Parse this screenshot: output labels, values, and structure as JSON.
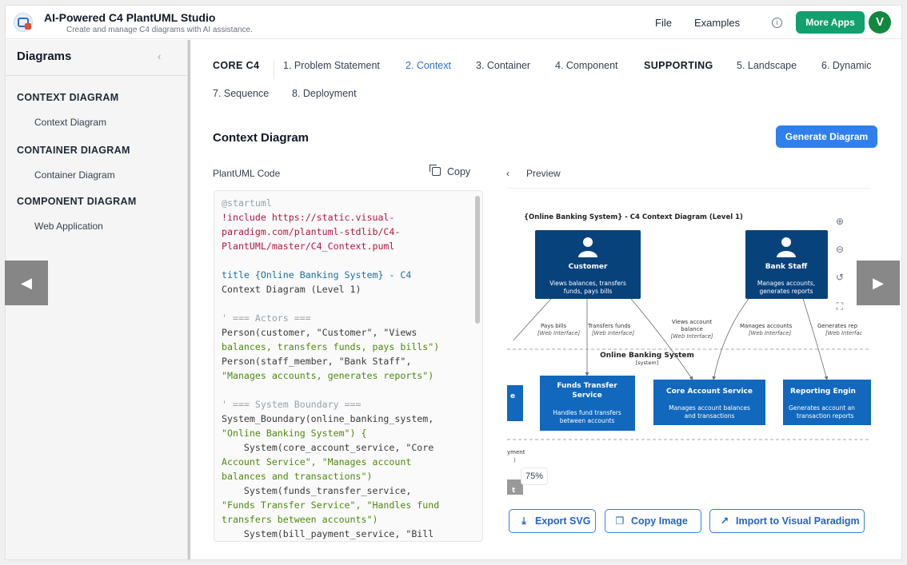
{
  "header": {
    "title": "AI-Powered C4 PlantUML Studio",
    "subtitle": "Create and manage C4 diagrams with AI assistance.",
    "nav_file": "File",
    "nav_examples": "Examples",
    "info_glyph": "i",
    "more_apps": "More Apps",
    "avatar_initial": "V"
  },
  "sidebar": {
    "title": "Diagrams",
    "collapse_glyph": "‹",
    "sections": [
      {
        "heading": "CONTEXT DIAGRAM",
        "item": "Context Diagram"
      },
      {
        "heading": "CONTAINER DIAGRAM",
        "item": "Container Diagram"
      },
      {
        "heading": "COMPONENT DIAGRAM",
        "item": "Web Application"
      }
    ]
  },
  "tabs": {
    "group_core": "CORE C4",
    "t1": "1. Problem Statement",
    "t2": "2. Context",
    "t3": "3. Container",
    "t4": "4. Component",
    "group_supporting": "SUPPORTING",
    "t5": "5. Landscape",
    "t6": "6. Dynamic",
    "t7": "7. Sequence",
    "t8": "8. Deployment"
  },
  "main": {
    "section_title": "Context Diagram",
    "generate_button": "Generate Diagram",
    "code_label": "PlantUML Code",
    "copy_label": "Copy",
    "preview_back_glyph": "‹",
    "preview_label": "Preview",
    "zoom_percent": "75%"
  },
  "code_lines": [
    {
      "text": "@startuml",
      "color": "gray"
    },
    {
      "text": "!include https://static.visual-",
      "color": "red"
    },
    {
      "text": "paradigm.com/plantuml-stdlib/C4-",
      "color": "red"
    },
    {
      "text": "PlantUML/master/C4_Context.puml",
      "color": "red"
    },
    {
      "text": "",
      "color": "dark"
    },
    {
      "text": "title {Online Banking System} - C4",
      "color": "blue"
    },
    {
      "text": "Context Diagram (Level 1)",
      "color": "dark"
    },
    {
      "text": "",
      "color": "dark"
    },
    {
      "text": "' === Actors ===",
      "color": "gray"
    },
    {
      "text": "Person(customer, \"Customer\", \"Views",
      "color": "dark"
    },
    {
      "text": "balances, transfers funds, pays bills\")",
      "color": "green"
    },
    {
      "text": "Person(staff_member, \"Bank Staff\",",
      "color": "dark"
    },
    {
      "text": "\"Manages accounts, generates reports\")",
      "color": "green"
    },
    {
      "text": "",
      "color": "dark"
    },
    {
      "text": "' === System Boundary ===",
      "color": "gray"
    },
    {
      "text": "System_Boundary(online_banking_system,",
      "color": "dark"
    },
    {
      "text": "\"Online Banking System\") {",
      "color": "green"
    },
    {
      "text": "    System(core_account_service, \"Core",
      "color": "dark"
    },
    {
      "text": "Account Service\", \"Manages account",
      "color": "green"
    },
    {
      "text": "balances and transactions\")",
      "color": "green"
    },
    {
      "text": "    System(funds_transfer_service,",
      "color": "dark"
    },
    {
      "text": "\"Funds Transfer Service\", \"Handles fund",
      "color": "green"
    },
    {
      "text": "transfers between accounts\")",
      "color": "green"
    },
    {
      "text": "    System(bill_payment_service, \"Bill",
      "color": "dark"
    }
  ],
  "diagram": {
    "title": "{Online Banking System} - C4 Context Diagram (Level 1)",
    "customer": {
      "name": "Customer",
      "desc1": "Views balances, transfers",
      "desc2": "funds, pays bills"
    },
    "staff": {
      "name": "Bank Staff",
      "desc1": "Manages accounts,",
      "desc2": "generates reports"
    },
    "edge_labels": [
      {
        "l1": "Pays bills",
        "l2": "[Web Interface]"
      },
      {
        "l1": "Transfers funds",
        "l2": "[Web Interface]"
      },
      {
        "l1": "Views account",
        "l2": "balance",
        "l3": "[Web Interface]"
      },
      {
        "l1": "Manages accounts",
        "l2": "[Web Interface]"
      },
      {
        "l1": "Generates rep",
        "l2": "[Web Interfac"
      }
    ],
    "boundary_name": "Online Banking System",
    "boundary_type": "[system]",
    "funds": {
      "n1": "Funds Transfer",
      "n2": "Service",
      "d1": "Handles fund transfers",
      "d2": "between accounts"
    },
    "core": {
      "n1": "Core Account Service",
      "d1": "Manages account balances",
      "d2": "and transactions"
    },
    "reporting": {
      "n1": "Reporting Engin",
      "d1": "Generates account an",
      "d2": "transaction reports"
    },
    "partial_e": "e",
    "partial_payment1": "yment",
    "partial_payment2": ")",
    "partial_t": "t"
  },
  "zoom_controls": [
    "zoom-in",
    "zoom-out",
    "reset",
    "fit"
  ],
  "actions": {
    "export_svg": "Export SVG",
    "copy_image": "Copy Image",
    "import_vp": "Import to Visual Paradigm"
  },
  "carousel": {
    "prev": "◀",
    "next": "▶"
  },
  "colors": {
    "accent": "#2f80ed",
    "green_button": "#12a06f",
    "person_fill": "#08427b",
    "system_fill": "#1168bd"
  }
}
